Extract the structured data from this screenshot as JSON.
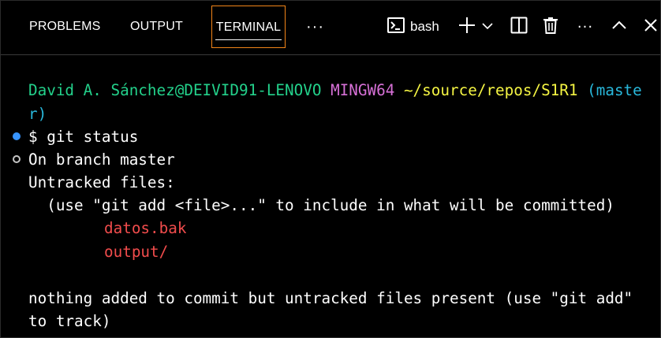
{
  "tabs": {
    "problems": "PROBLEMS",
    "output": "OUTPUT",
    "terminal": "TERMINAL",
    "more": "···"
  },
  "toolbar": {
    "shell_label": "bash",
    "more": "···",
    "icons": [
      "terminal-icon",
      "plus-icon",
      "chevron-down-icon",
      "split-icon",
      "trash-icon",
      "ellipsis-icon",
      "chevron-up-icon",
      "close-icon"
    ]
  },
  "terminal": {
    "prompt": {
      "user_host": "David A. Sánchez@DEIVID91-LENOVO",
      "system": "MINGW64",
      "path": "~/source/repos/S1R1",
      "branch_part1": "(maste",
      "branch_part2": "r)"
    },
    "command": "$ git status",
    "output": {
      "line1": "On branch master",
      "line2": "Untracked files:",
      "line3": "  (use \"git add <file>...\" to include in what will be committed)",
      "files": [
        "datos.bak",
        "output/"
      ],
      "line4": "nothing added to commit but untracked files present (use \"git add\"",
      "line5": "to track)"
    }
  },
  "colors": {
    "user": "#23d18b",
    "system": "#d670d6",
    "path": "#f5f543",
    "branch": "#29b8db",
    "untracked": "#f14c4c",
    "active_tab_border": "#f38518",
    "command_decoration": "#3794ff"
  }
}
